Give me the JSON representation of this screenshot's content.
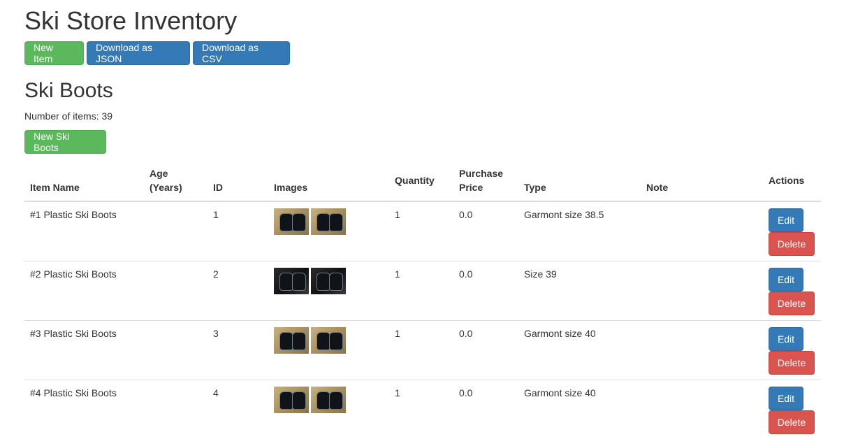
{
  "page": {
    "title": "Ski Store Inventory"
  },
  "toolbar": {
    "new_item": "New Item",
    "download_json": "Download as JSON",
    "download_csv": "Download as CSV"
  },
  "section": {
    "title": "Ski Boots",
    "count_label": "Number of items: 39",
    "new_button": "New Ski Boots"
  },
  "table": {
    "headers": {
      "item_name": "Item Name",
      "age_line1": "Age",
      "age_line2": "(Years)",
      "id": "ID",
      "images": "Images",
      "quantity": "Quantity",
      "price_line1": "Purchase",
      "price_line2": "Price",
      "type": "Type",
      "note": "Note",
      "actions": "Actions"
    },
    "rows": [
      {
        "name": "#1 Plastic Ski Boots",
        "age": "",
        "id": "1",
        "quantity": "1",
        "price": "0.0",
        "type": "Garmont size 38.5",
        "note": ""
      },
      {
        "name": "#2 Plastic Ski Boots",
        "age": "",
        "id": "2",
        "quantity": "1",
        "price": "0.0",
        "type": "Size 39",
        "note": ""
      },
      {
        "name": "#3 Plastic Ski Boots",
        "age": "",
        "id": "3",
        "quantity": "1",
        "price": "0.0",
        "type": "Garmont size 40",
        "note": ""
      },
      {
        "name": "#4 Plastic Ski Boots",
        "age": "",
        "id": "4",
        "quantity": "1",
        "price": "0.0",
        "type": "Garmont size 40",
        "note": ""
      }
    ],
    "edit_label": "Edit",
    "delete_label": "Delete"
  },
  "colors": {
    "success": "#5cb85c",
    "primary": "#337ab7",
    "danger": "#d9534f"
  }
}
